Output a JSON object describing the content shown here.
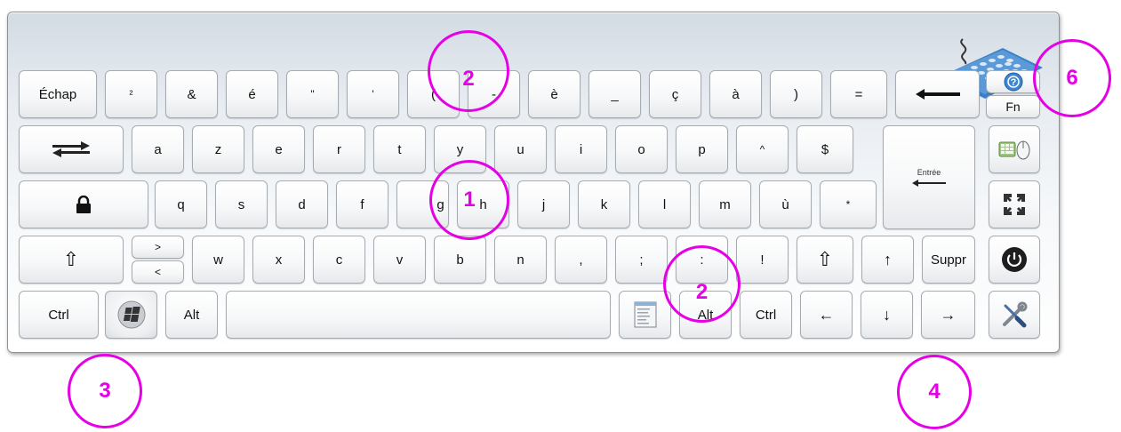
{
  "keyboard": {
    "row1": [
      "Échap",
      "²",
      "&",
      "é",
      "\"",
      "'",
      "(",
      "-",
      "è",
      "_",
      "ç",
      "à",
      ")",
      "="
    ],
    "row2": [
      "a",
      "z",
      "e",
      "r",
      "t",
      "y",
      "u",
      "i",
      "o",
      "p",
      "^",
      "$"
    ],
    "row3": [
      "q",
      "s",
      "d",
      "f",
      "g",
      "h",
      "j",
      "k",
      "l",
      "m",
      "ù",
      "*"
    ],
    "row4": [
      ">",
      "<",
      "w",
      "x",
      "c",
      "v",
      "b",
      "n",
      ",",
      ";",
      ":",
      "!"
    ],
    "enter_label": "Entrée",
    "fn_label": "Fn",
    "suppr_label": "Suppr",
    "ctrl_label": "Ctrl",
    "alt_label": "Alt",
    "arrows": {
      "up": "↑",
      "left": "←",
      "down": "↓",
      "right": "→"
    },
    "shift_glyph": "⇧"
  },
  "annotations": {
    "one": "1",
    "two_top": "2",
    "two_bottom": "2",
    "three": "3",
    "four": "4",
    "six": "6"
  },
  "colors": {
    "annotation": "#e600e6",
    "frame_border": "#8e9296"
  }
}
